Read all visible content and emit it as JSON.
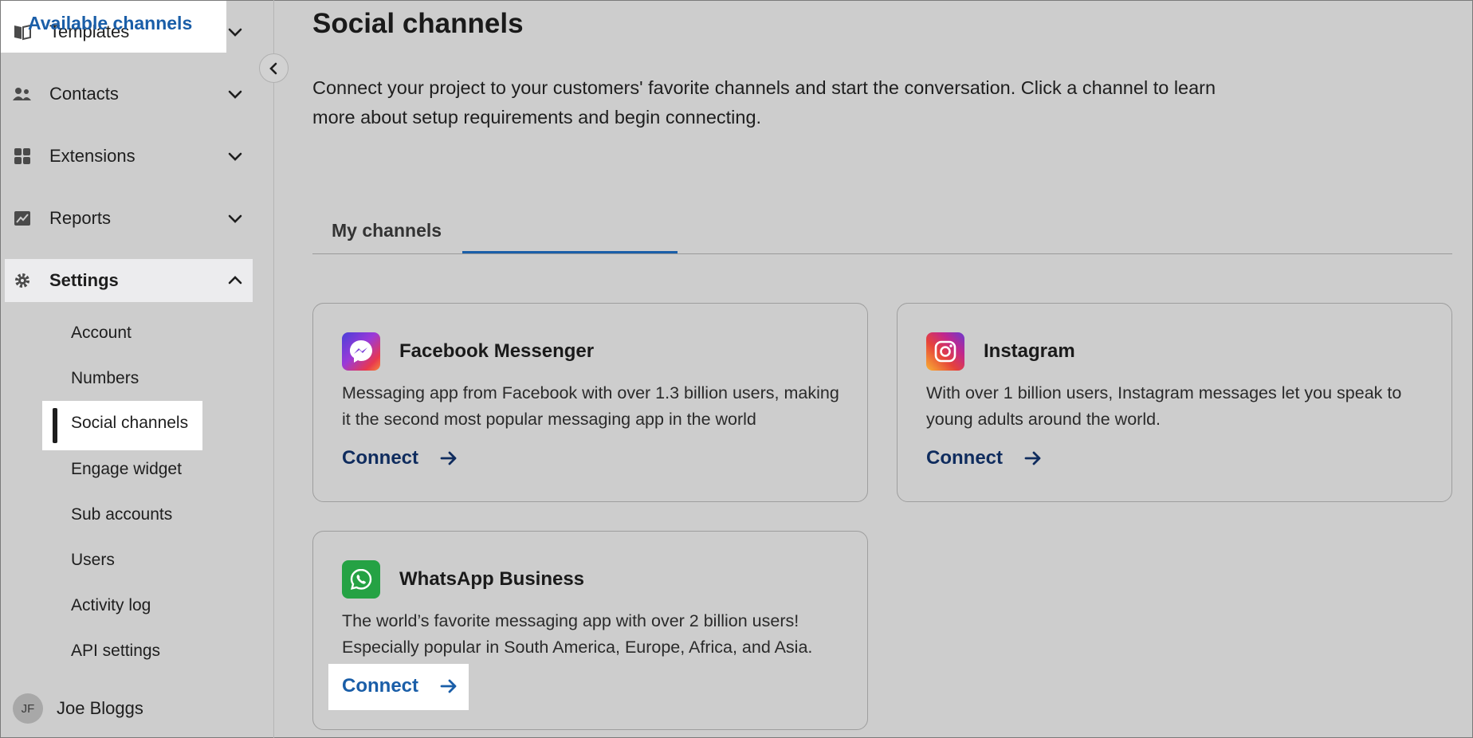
{
  "sidebar": {
    "items": [
      {
        "label": "Templates",
        "icon": "book-icon"
      },
      {
        "label": "Contacts",
        "icon": "people-icon"
      },
      {
        "label": "Extensions",
        "icon": "grid-icon"
      },
      {
        "label": "Reports",
        "icon": "chart-icon"
      },
      {
        "label": "Settings",
        "icon": "gear-icon"
      }
    ],
    "settings_sub": [
      {
        "label": "Account"
      },
      {
        "label": "Numbers"
      },
      {
        "label": "Social channels"
      },
      {
        "label": "Engage widget"
      },
      {
        "label": "Sub accounts"
      },
      {
        "label": "Users"
      },
      {
        "label": "Activity log"
      },
      {
        "label": "API settings"
      }
    ],
    "user": {
      "initials": "JF",
      "name": "Joe Bloggs"
    }
  },
  "page": {
    "title": "Social channels",
    "intro": "Connect your project to your customers' favorite channels and start the conversation. Click a channel to learn more about setup requirements and begin connecting.",
    "tabs": [
      {
        "label": "My channels"
      },
      {
        "label": "Available channels"
      }
    ]
  },
  "cards": [
    {
      "title": "Facebook Messenger",
      "description": "Messaging app from Facebook with over 1.3 billion users, making it the second most popular messaging app in the world",
      "action": "Connect",
      "icon": "messenger-icon"
    },
    {
      "title": "Instagram",
      "description": "With over 1 billion users, Instagram messages let you speak to young adults around the world.",
      "action": "Connect",
      "icon": "instagram-icon"
    },
    {
      "title": "WhatsApp Business",
      "description": "The world’s favorite messaging app with over 2 billion users! Especially popular in South America, Europe, Africa, and Asia.",
      "action": "Connect",
      "icon": "whatsapp-icon"
    }
  ],
  "colors": {
    "background": "#cdcdcd",
    "accent": "#1a5ea8",
    "link": "#0f2c5e",
    "highlight": "#ffffff",
    "whatsapp": "#25a244"
  }
}
